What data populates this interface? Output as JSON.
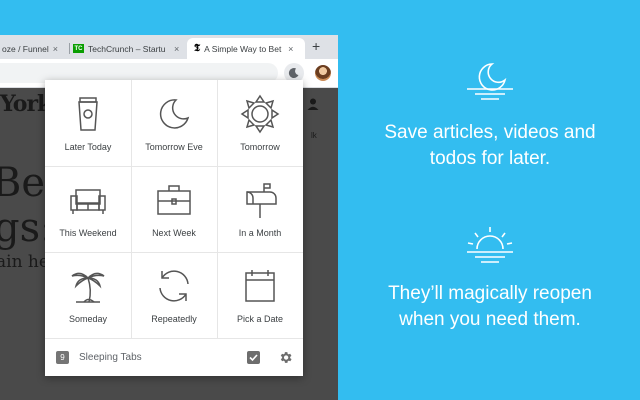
{
  "browser": {
    "tabs": [
      {
        "title": "oze / Funnel",
        "favicon": "",
        "active": false
      },
      {
        "title": "TechCrunch – Startu",
        "favicon": "TC",
        "active": false
      },
      {
        "title": "A Simple Way to Bet",
        "favicon": "nyt-icon",
        "active": true
      }
    ],
    "new_tab": "+",
    "close_glyph": "×"
  },
  "page": {
    "logo": "York",
    "line1": "Be",
    "line2": "gs:",
    "line3": "ain hel",
    "side_marker": "lk"
  },
  "popup": {
    "options": [
      {
        "label": "Later Today",
        "icon": "coffee-cup-icon"
      },
      {
        "label": "Tomorrow Eve",
        "icon": "moon-icon"
      },
      {
        "label": "Tomorrow",
        "icon": "sun-icon"
      },
      {
        "label": "This Weekend",
        "icon": "sofa-icon"
      },
      {
        "label": "Next Week",
        "icon": "briefcase-icon"
      },
      {
        "label": "In a Month",
        "icon": "mailbox-icon"
      },
      {
        "label": "Someday",
        "icon": "palm-tree-icon"
      },
      {
        "label": "Repeatedly",
        "icon": "repeat-icon"
      },
      {
        "label": "Pick a Date",
        "icon": "calendar-icon"
      }
    ],
    "footer": {
      "count": "9",
      "label": "Sleeping Tabs"
    }
  },
  "promo": {
    "text1_line1": "Save articles, videos and",
    "text1_line2": "todos for later.",
    "text2_line1": "They’ll magically reopen",
    "text2_line2": "when you need them."
  },
  "colors": {
    "background": "#33bdf0",
    "icon_stroke": "#555555",
    "text": "#ffffff"
  }
}
